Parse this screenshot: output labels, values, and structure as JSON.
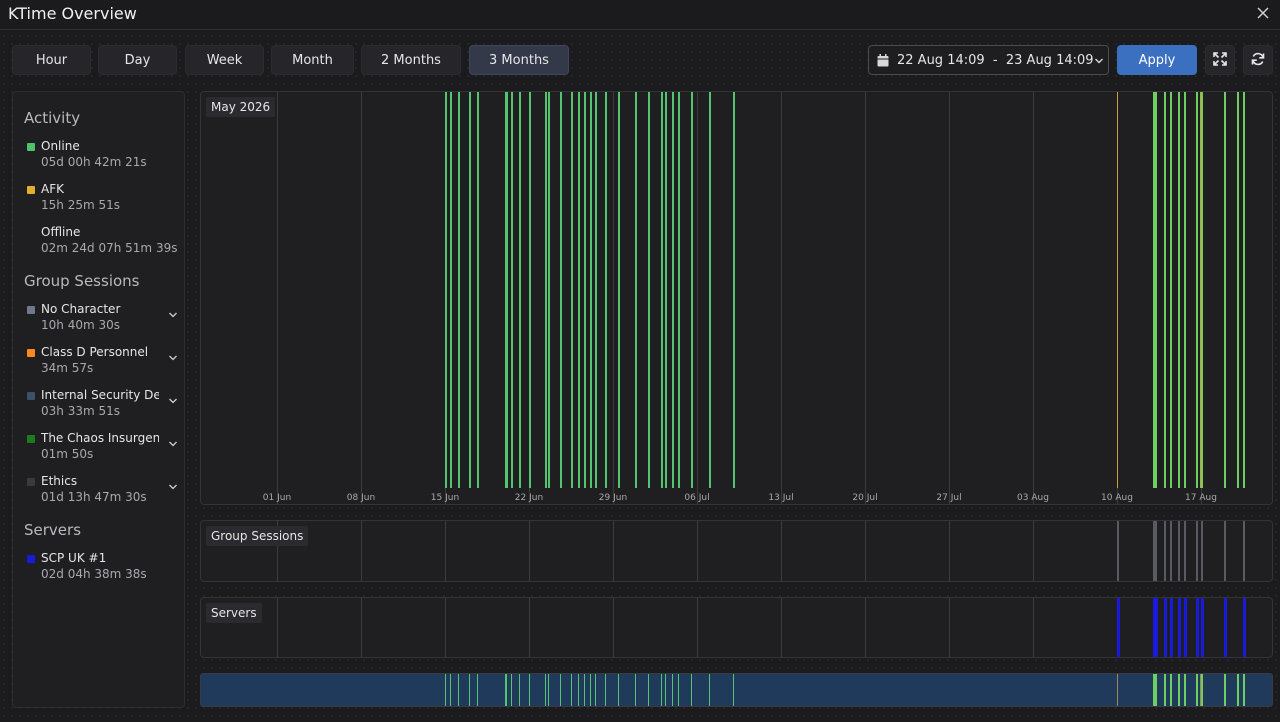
{
  "window": {
    "title": "KTime Overview"
  },
  "range_buttons": [
    {
      "label": "Hour",
      "active": false
    },
    {
      "label": "Day",
      "active": false
    },
    {
      "label": "Week",
      "active": false
    },
    {
      "label": "Month",
      "active": false
    },
    {
      "label": "2 Months",
      "active": false
    },
    {
      "label": "3 Months",
      "active": true
    }
  ],
  "date_range": {
    "value": "22 Aug 14:09  -  23 Aug 14:09",
    "icon": "calendar-icon"
  },
  "apply_label": "Apply",
  "sidebar": {
    "activity_title": "Activity",
    "activity": [
      {
        "label": "Online",
        "value": "05d 00h 42m 21s",
        "color": "#4cc36a"
      },
      {
        "label": "AFK",
        "value": "15h 25m 51s",
        "color": "#e0b02a"
      },
      {
        "label": "Offline",
        "value": "02m 24d 07h 51m 39s",
        "color": "#1f1f22"
      }
    ],
    "groups_title": "Group Sessions",
    "groups": [
      {
        "label": "No Character",
        "value": "10h 40m 30s",
        "color": "#6e7a8a"
      },
      {
        "label": "Class D Personnel",
        "value": "34m 57s",
        "color": "#ff8a1a"
      },
      {
        "label": "Internal Security Dep",
        "value": "03h 33m 51s",
        "color": "#3e5068"
      },
      {
        "label": "The Chaos Insurgenc",
        "value": "01m 50s",
        "color": "#1e7a1e"
      },
      {
        "label": "Ethics",
        "value": "01d 13h 47m 30s",
        "color": "#3a3a3a"
      }
    ],
    "servers_title": "Servers",
    "servers": [
      {
        "label": "SCP UK #1",
        "value": "02d 04h 38m 38s",
        "color": "#1a1adc"
      }
    ]
  },
  "timeline": {
    "month_label": "May 2026",
    "group_label": "Group Sessions",
    "servers_label": "Servers",
    "ticks": [
      "01 Jun",
      "08 Jun",
      "15 Jun",
      "22 Jun",
      "29 Jun",
      "06 Jul",
      "13 Jul",
      "20 Jul",
      "27 Jul",
      "03 Aug",
      "10 Aug",
      "17 Aug"
    ],
    "online_days": [
      14.0,
      14.4,
      15.1,
      16.0,
      16.7,
      19.0,
      19.1,
      19.5,
      20.2,
      21.0,
      22.3,
      22.6,
      23.6,
      24.5,
      25.1,
      25.6,
      26.1,
      26.5,
      27.3,
      28.4,
      29.8,
      30.9,
      32.0,
      32.3,
      32.9,
      33.4,
      34.5,
      36.0,
      38.0
    ],
    "afk_days": [
      70.0,
      76.9
    ],
    "online_late_days": [
      73.0,
      73.2,
      73.9,
      74.4,
      75.1,
      75.6,
      76.6,
      77.0,
      78.9,
      80.0,
      80.5
    ],
    "group_days": [
      70.0,
      73.0,
      73.2,
      73.9,
      74.4,
      75.1,
      75.6,
      76.6,
      77.0,
      78.9,
      80.5
    ],
    "server_days": [
      70.0,
      73.0,
      73.2,
      73.9,
      74.4,
      75.1,
      75.6,
      76.6,
      77.0,
      78.9,
      80.5
    ]
  }
}
